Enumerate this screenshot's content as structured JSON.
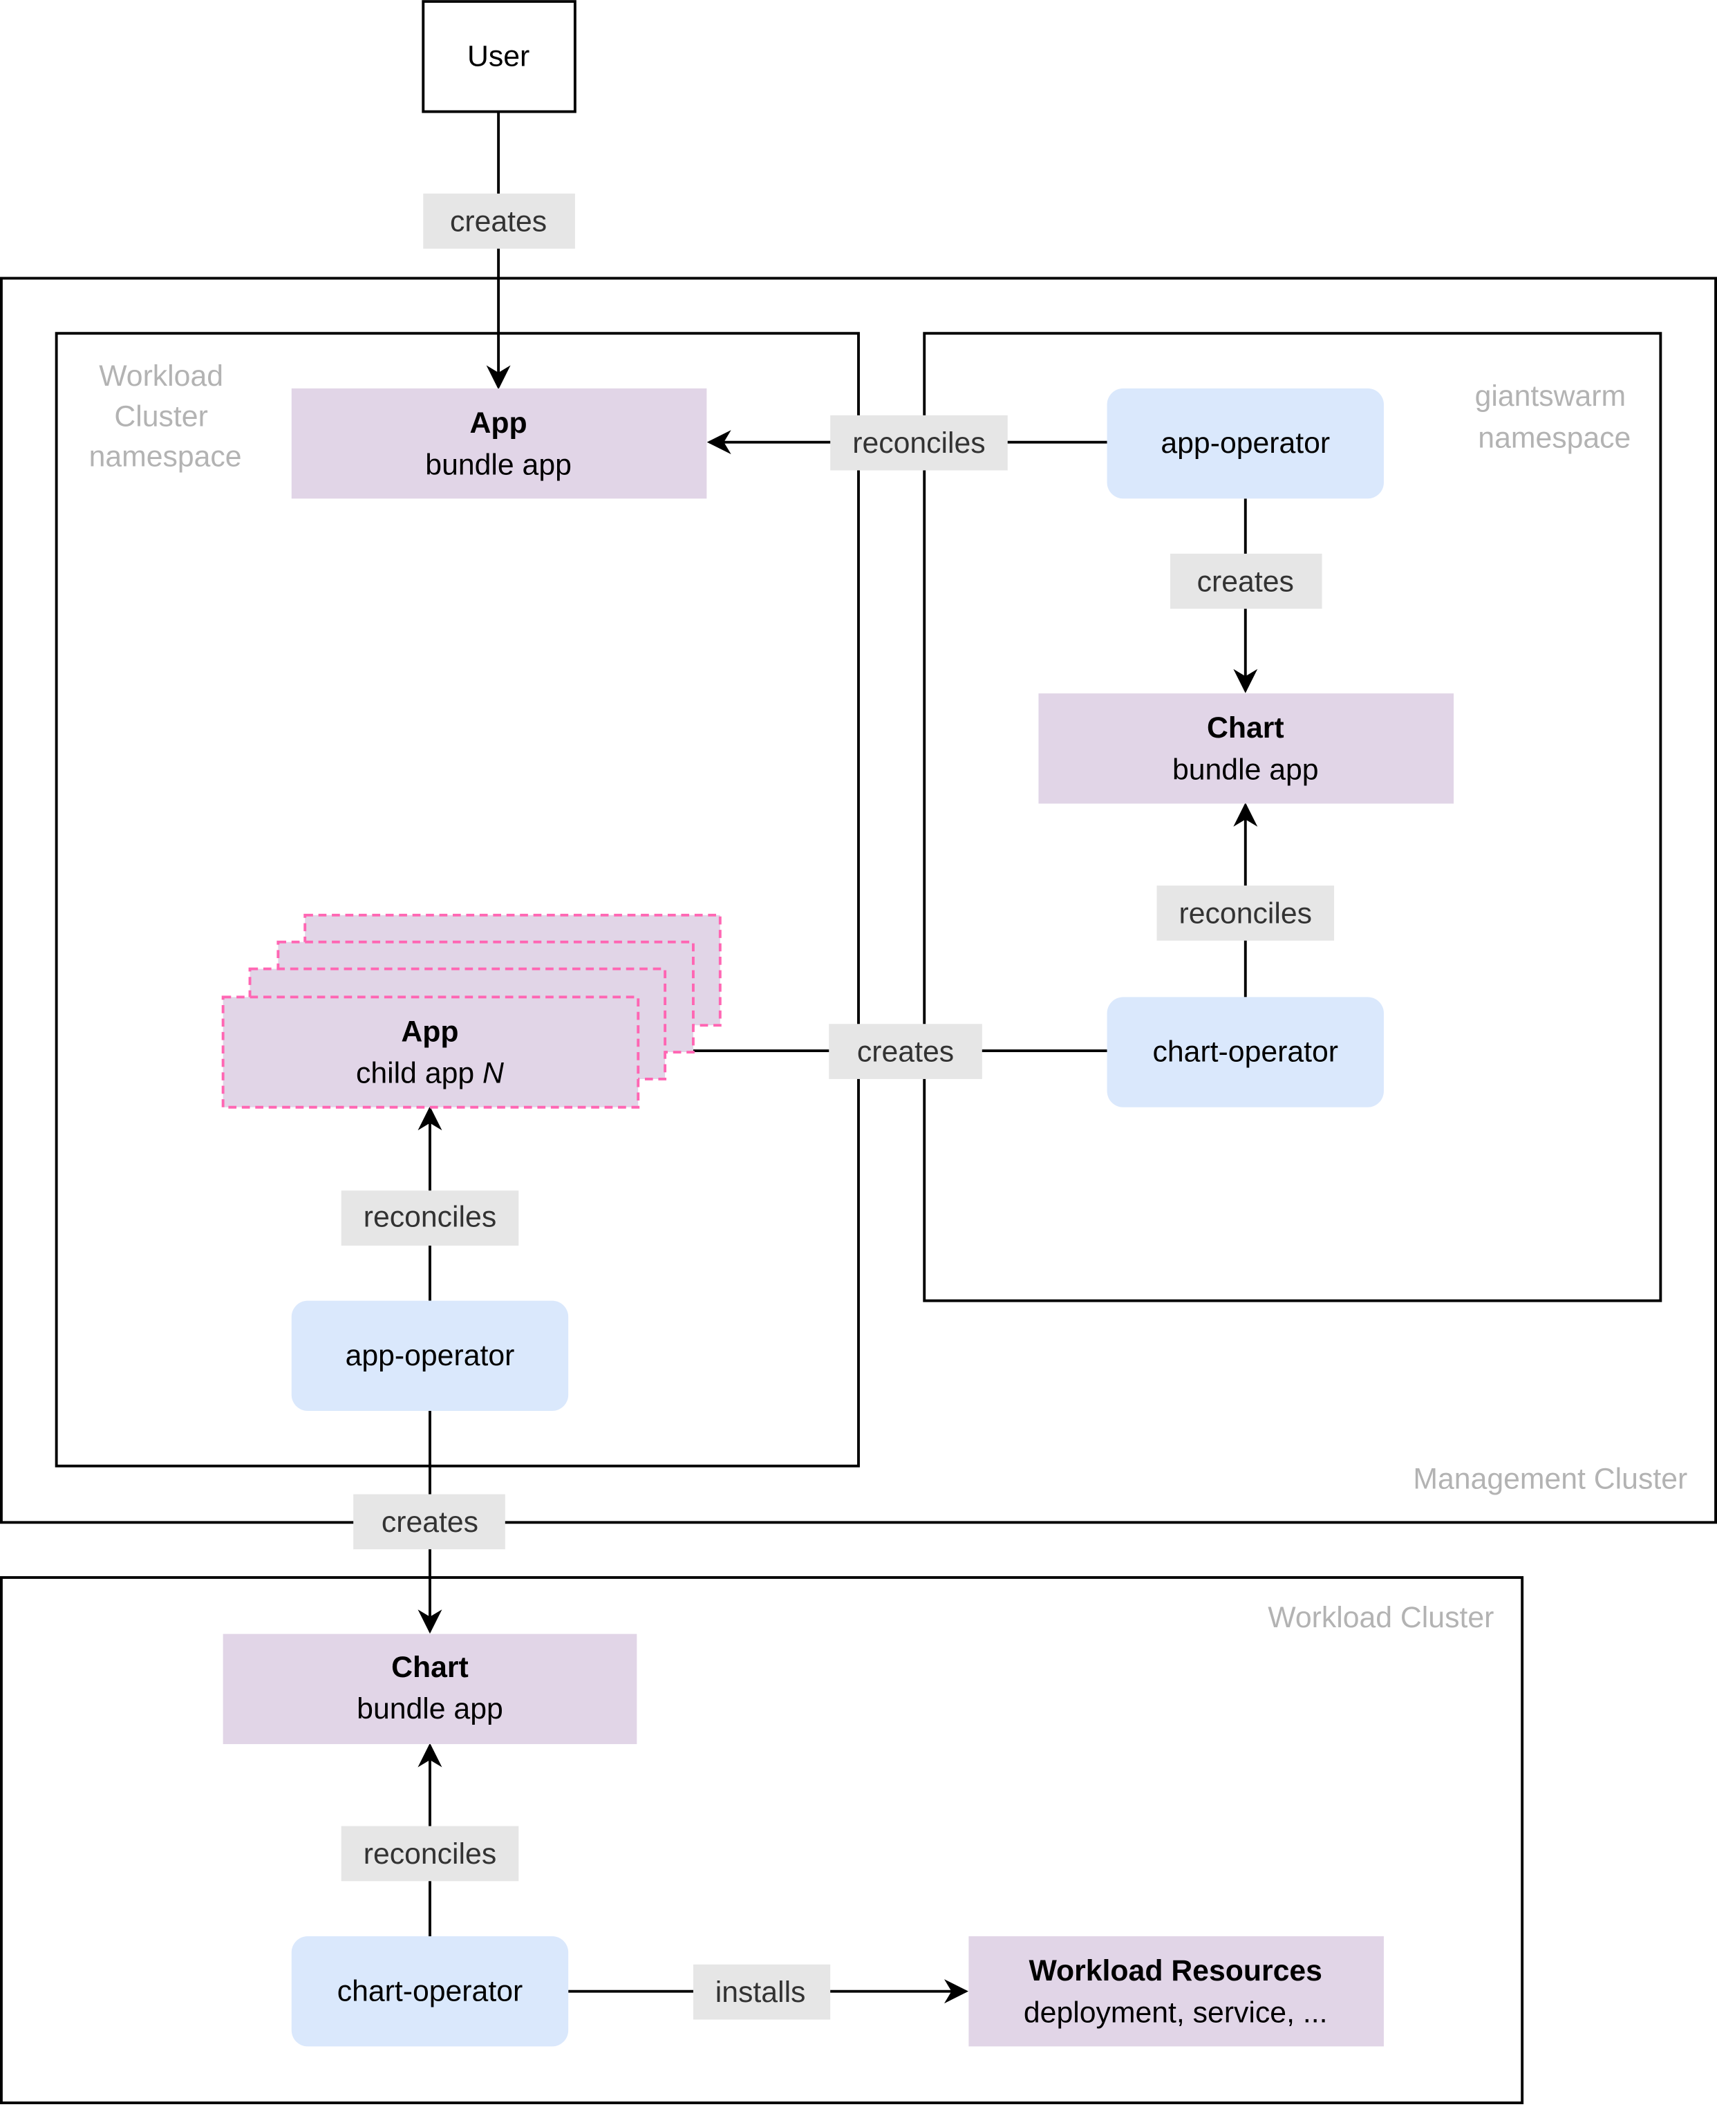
{
  "colors": {
    "resource_fill": "#e1d5e7",
    "operator_fill": "#dae8fc",
    "edge_label_bg": "#e6e6e6",
    "dashed_border": "#ff66b3",
    "container_label": "#b3b3b3"
  },
  "containers": {
    "management_cluster": "Management Cluster",
    "workload_cluster_namespace": [
      "Workload",
      "Cluster",
      "namespace"
    ],
    "giantswarm_namespace": [
      "giantswarm",
      "namespace"
    ],
    "workload_cluster": "Workload Cluster"
  },
  "nodes": {
    "user": {
      "title": "User"
    },
    "app_bundle": {
      "title": "App",
      "subtitle": "bundle app"
    },
    "app_operator_gs": {
      "title": "app-operator"
    },
    "chart_bundle_gs": {
      "title": "Chart",
      "subtitle": "bundle app"
    },
    "chart_operator_gs": {
      "title": "chart-operator"
    },
    "app_child": {
      "title": "App",
      "subtitle_prefix": "child app ",
      "subtitle_italic": "N"
    },
    "app_operator_wc": {
      "title": "app-operator"
    },
    "chart_bundle_wc": {
      "title": "Chart",
      "subtitle": "bundle app"
    },
    "chart_operator_wc": {
      "title": "chart-operator"
    },
    "workload_resources": {
      "title": "Workload Resources",
      "subtitle": "deployment, service, ..."
    }
  },
  "edges": {
    "user_creates_app": "creates",
    "appop_reconciles_app": "reconciles",
    "appop_creates_chart": "creates",
    "chartop_reconciles_chart": "reconciles",
    "chartop_creates_child": "creates",
    "appop_reconciles_child": "reconciles",
    "appop_creates_chart_wc": "creates",
    "chartop_reconciles_chart_wc": "reconciles",
    "chartop_installs_resources": "installs"
  }
}
